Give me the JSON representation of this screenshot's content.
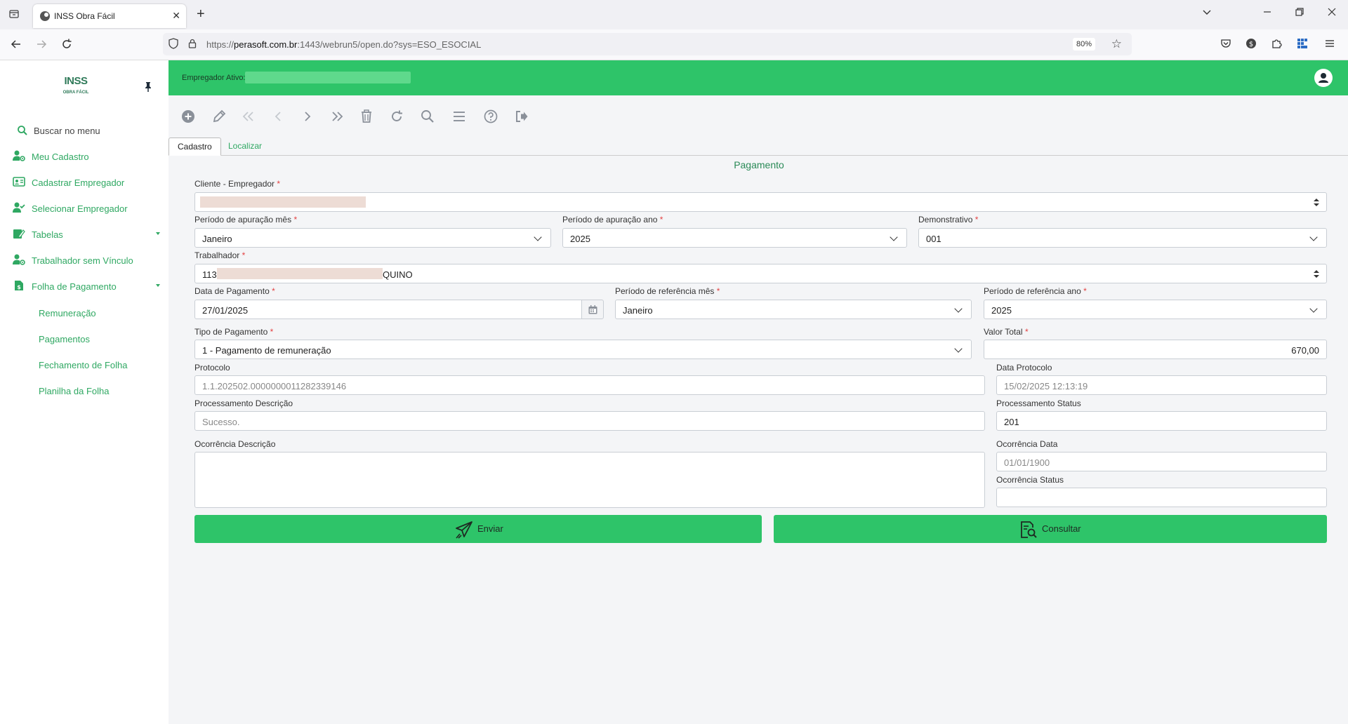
{
  "browser": {
    "tab_title": "INSS Obra Fácil",
    "url_domain": "perasoft.com.br",
    "url_prefix": "https://",
    "url_rest": ":1443/webrun5/open.do?sys=ESO_ESOCIAL",
    "zoom": "80%"
  },
  "sidebar": {
    "logo_main": "INSS",
    "logo_sub": "OBRA FÁCIL",
    "search_label": "Buscar no menu",
    "items": [
      {
        "label": "Meu Cadastro",
        "icon": "user-gear-icon"
      },
      {
        "label": "Cadastrar Empregador",
        "icon": "id-card-icon"
      },
      {
        "label": "Selecionar Empregador",
        "icon": "user-check-icon"
      },
      {
        "label": "Tabelas",
        "icon": "edit-table-icon"
      },
      {
        "label": "Trabalhador sem Vínculo",
        "icon": "user-gear-icon"
      },
      {
        "label": "Folha de Pagamento",
        "icon": "file-dollar-icon"
      }
    ],
    "subitems": [
      "Remuneração",
      "Pagamentos",
      "Fechamento de Folha",
      "Planilha da Folha"
    ]
  },
  "header": {
    "employer_label": "Empregador Ativo:"
  },
  "tabs": {
    "cadastro": "Cadastro",
    "localizar": "Localizar"
  },
  "form": {
    "title": "Pagamento",
    "cliente_label": "Cliente - Empregador",
    "periodo_mes_label": "Período de apuração mês",
    "periodo_mes_value": "Janeiro",
    "periodo_ano_label": "Período de apuração ano",
    "periodo_ano_value": "2025",
    "demonstrativo_label": "Demonstrativo",
    "demonstrativo_value": "001",
    "trabalhador_label": "Trabalhador",
    "trabalhador_prefix": "113",
    "trabalhador_suffix": "QUINO",
    "data_pagamento_label": "Data de Pagamento",
    "data_pagamento_value": "27/01/2025",
    "ref_mes_label": "Período de referência mês",
    "ref_mes_value": "Janeiro",
    "ref_ano_label": "Período de referência ano",
    "ref_ano_value": "2025",
    "tipo_pagamento_label": "Tipo de Pagamento",
    "tipo_pagamento_value": "1 - Pagamento de remuneração",
    "valor_total_label": "Valor Total",
    "valor_total_value": "670,00",
    "protocolo_label": "Protocolo",
    "protocolo_value": "1.1.202502.0000000011282339146",
    "data_protocolo_label": "Data Protocolo",
    "data_protocolo_value": "15/02/2025 12:13:19",
    "proc_desc_label": "Processamento Descrição",
    "proc_desc_value": "Sucesso.",
    "proc_status_label": "Processamento Status",
    "proc_status_value": "201",
    "ocorr_desc_label": "Ocorrência Descrição",
    "ocorr_data_label": "Ocorrência Data",
    "ocorr_data_value": "01/01/1900",
    "ocorr_status_label": "Ocorrência Status",
    "required_mark": "*"
  },
  "actions": {
    "enviar": "Enviar",
    "consultar": "Consultar"
  },
  "colors": {
    "brand_green": "#2ec469",
    "link_green": "#2fa862"
  }
}
